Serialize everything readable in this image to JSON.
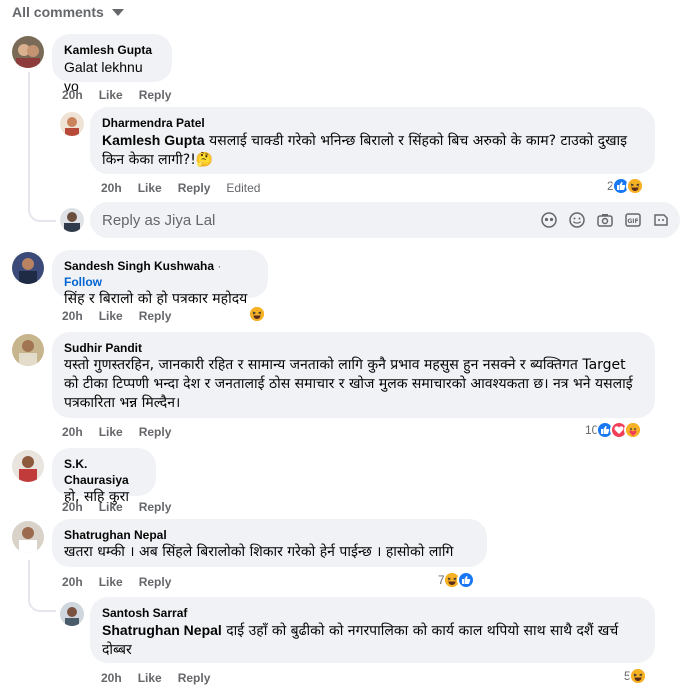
{
  "filter": {
    "label": "All comments"
  },
  "reply_box": {
    "placeholder": "Reply as Jiya Lal"
  },
  "comments": [
    {
      "author": "Kamlesh Gupta",
      "text": "Galat lekhnu vo",
      "time": "20h",
      "like": "Like",
      "reply": "Reply"
    },
    {
      "author": "Dharmendra Patel",
      "mention": "Kamlesh Gupta",
      "text": "यसलाई चाक्डी गरेको भनिन्छ बिरालो र सिंहको बिच अरुको के काम? टाउको दुखाइ किन केका लागी?!🤔",
      "time": "20h",
      "like": "Like",
      "reply": "Reply",
      "edited": "Edited",
      "reaction_count": "2"
    },
    {
      "author": "Sandesh Singh Kushwaha",
      "follow": "Follow",
      "text": "सिंह र बिरालो को हो पत्रकार महोदय",
      "time": "20h",
      "like": "Like",
      "reply": "Reply"
    },
    {
      "author": "Sudhir Pandit",
      "text": "यस्तो गुणस्तरहिन, जानकारी रहित र सामान्य जनताको लागि कुनै प्रभाव महसुस हुन नसक्ने र ब्यक्तिगत Target को टीका टिप्पणी भन्दा देश र जनतालाई ठोस समाचार र खोज मुलक समाचारको आवश्यकता छ। नत्र भने यसलाई पत्रकारिता भन्न मिल्दैन।",
      "time": "20h",
      "like": "Like",
      "reply": "Reply",
      "reaction_count": "10"
    },
    {
      "author": "S.K. Chaurasiya",
      "text": "हो, सहि कुरा",
      "time": "20h",
      "like": "Like",
      "reply": "Reply"
    },
    {
      "author": "Shatrughan Nepal",
      "text": "खतरा धम्की । अब सिंहले बिरालोको शिकार गरेको हेर्न पाईन्छ । हासोको लागि",
      "time": "20h",
      "like": "Like",
      "reply": "Reply",
      "reaction_count": "7"
    },
    {
      "author": "Santosh Sarraf",
      "mention": "Shatrughan Nepal",
      "text": "दाई उहाँ को बुढीको को नगरपालिका को कार्य काल थपियो साथ साथै दशैं खर्च दोब्बर",
      "time": "20h",
      "like": "Like",
      "reply": "Reply",
      "reaction_count": "5"
    }
  ],
  "colors": {
    "like_blue": "#1877f2",
    "haha_yellow": "#f7b125",
    "love_red": "#f33e58",
    "bubble_bg": "#f0f2f5",
    "meta_gray": "#65676b",
    "link_blue": "#0064d1"
  },
  "icons": [
    "chevron-down-icon",
    "like-reaction-icon",
    "haha-reaction-icon",
    "love-reaction-icon",
    "care-reaction-icon",
    "sticker-icon",
    "emoji-icon",
    "camera-icon",
    "gif-icon",
    "avatar-sticker-icon"
  ]
}
